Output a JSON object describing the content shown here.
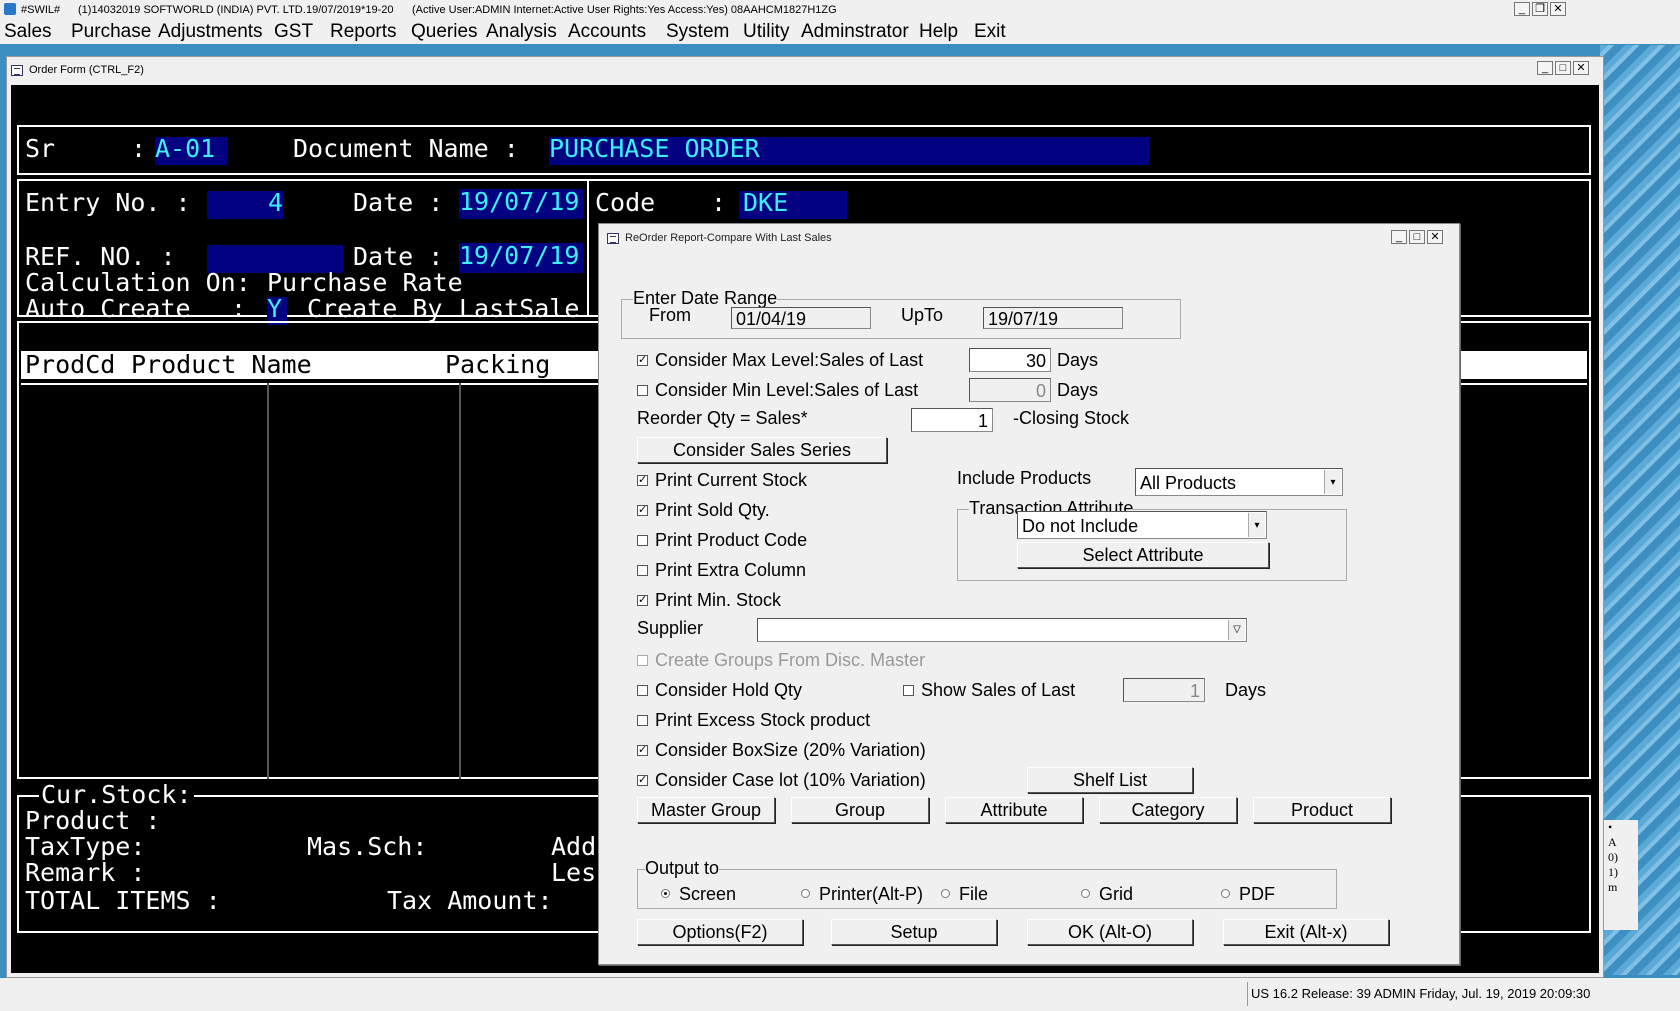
{
  "titlebar": {
    "app_tag": "#SWIL#",
    "company": "(1)14032019 SOFTWORLD (INDIA) PVT. LTD.",
    "period": "19/07/2019*19-20",
    "session": "(Active User:ADMIN Internet:Active  User Rights:Yes Access:Yes) 08AAHCM1827H1ZG"
  },
  "menu": [
    "Sales",
    "Purchase",
    "Adjustments",
    "GST",
    "Reports",
    "Queries",
    "Analysis",
    "Accounts",
    "System",
    "Utility",
    "Adminstrator",
    "Help",
    "Exit"
  ],
  "order_window": {
    "title": "Order Form (CTRL_F2)",
    "sr_label": "Sr",
    "sr_value": "A-01",
    "doc_name_label": "Document Name :",
    "doc_name_value": "PURCHASE ORDER",
    "entry_no_label": "Entry No. :",
    "entry_no_value": "4",
    "date_label": "Date :",
    "date_value": "19/07/19",
    "code_label": "Code",
    "code_value": "DKE",
    "ref_no_label": "REF.  NO. :",
    "ref_date_label": "Date :",
    "ref_date_value": "19/07/19",
    "calc_on_label": "Calculation On:",
    "calc_on_value": "Purchase Rate",
    "auto_create_label": "Auto Create",
    "auto_create_value": "Y",
    "create_by_label": "Create By",
    "create_by_value": "LastSale",
    "grid_headers": [
      "ProdCd",
      "Product Name",
      "Packing"
    ],
    "cur_stock_label": "Cur.Stock:",
    "product_label": "Product :",
    "taxtype_label": "TaxType:",
    "massch_label": "Mas.Sch:",
    "add_label": "Add",
    "remark_label": "Remark :",
    "less_label": "Less",
    "total_items_label": "TOTAL ITEMS :",
    "tax_amount_label": "Tax Amount:"
  },
  "dialog": {
    "title": "ReOrder Report-Compare With Last Sales",
    "date_range_label": "Enter Date Range",
    "from_label": "From",
    "from_value": "01/04/19",
    "upto_label": "UpTo",
    "upto_value": "19/07/19",
    "max_level_label": "Consider Max Level:Sales of Last",
    "max_level_checked": true,
    "max_level_value": "30",
    "min_level_label": "Consider Min Level:Sales of Last",
    "min_level_checked": false,
    "min_level_value": "0",
    "days_label": "Days",
    "reorder_label": "Reorder Qty = Sales*",
    "reorder_value": "1",
    "closing_stock_label": "-Closing Stock",
    "sales_series_button": "Consider Sales Series",
    "print_current_stock": "Print Current Stock",
    "print_sold_qty": "Print Sold Qty.",
    "print_product_code": "Print Product Code",
    "print_extra_column": "Print Extra Column",
    "print_min_stock": "Print Min. Stock",
    "include_products_label": "Include Products",
    "include_products_value": "All Products",
    "transaction_attr_label": "Transaction Attribute",
    "transaction_attr_value": "Do not Include",
    "select_attribute_button": "Select Attribute",
    "supplier_label": "Supplier",
    "supplier_value": "",
    "create_groups_label": "Create Groups From Disc. Master",
    "hold_qty_label": "Consider Hold Qty",
    "show_sales_label": "Show Sales of Last",
    "show_sales_value": "1",
    "excess_stock_label": "Print Excess Stock product",
    "boxsize_label": "Consider BoxSize (20% Variation)",
    "caselot_label": "Consider Case lot (10% Variation)",
    "shelf_list_button": "Shelf List",
    "master_group_button": "Master Group",
    "group_button": "Group",
    "attribute_button": "Attribute",
    "category_button": "Category",
    "product_button": "Product",
    "output_label": "Output to",
    "output_options": [
      "Screen",
      "Printer(Alt-P)",
      "File",
      "Grid",
      "PDF"
    ],
    "output_selected": "Screen",
    "options_button": "Options(F2)",
    "setup_button": "Setup",
    "ok_button": "OK (Alt-O)",
    "exit_button": "Exit (Alt-x)"
  },
  "statusbar": {
    "text": "US 16.2 Release: 39 ADMIN  Friday, Jul. 19, 2019  20:09:30"
  },
  "colors": {
    "console_bg": "#000000",
    "field_bg": "#000080",
    "field_text": "#3cf0ff",
    "dialog_bg": "#f0f0f0"
  }
}
